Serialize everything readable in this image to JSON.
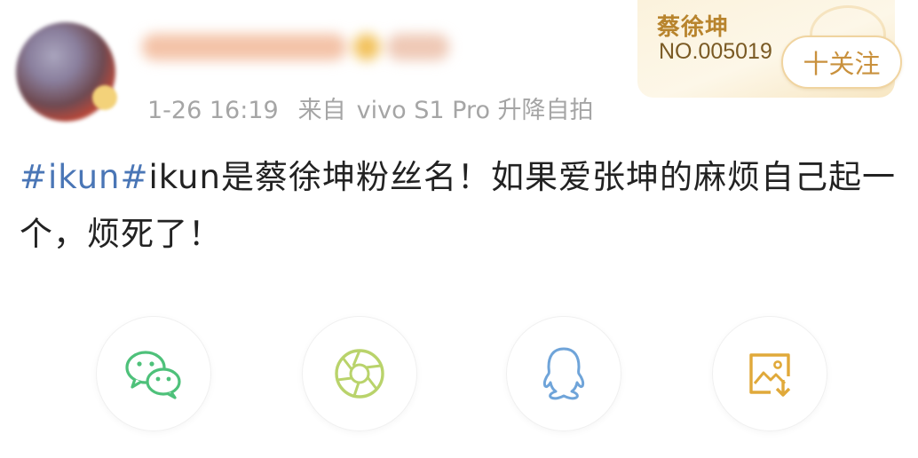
{
  "header": {
    "username": "",
    "timestamp": "1-26 16:19",
    "source_prefix": "来自",
    "source_device": "vivo S1 Pro 升降自拍"
  },
  "fan_badge": {
    "name": "蔡徐坤",
    "number": "NO.005019"
  },
  "follow_button": {
    "label": "十关注"
  },
  "post": {
    "hashtag": "#ikun#",
    "text": "ikun是蔡徐坤粉丝名！如果爱张坤的麻烦自己起一个，烦死了！"
  },
  "share": {
    "items": [
      {
        "icon": "wechat-icon",
        "color": "#4ec17a"
      },
      {
        "icon": "moments-icon",
        "color": "#b9d36b"
      },
      {
        "icon": "qq-icon",
        "color": "#6fa4d9"
      },
      {
        "icon": "save-image-icon",
        "color": "#e0a93a"
      }
    ]
  },
  "colors": {
    "hashtag": "#4a76b6",
    "meta_text": "#a5a5a5",
    "badge_gold": "#b8842d",
    "follow_text": "#c9913d"
  }
}
